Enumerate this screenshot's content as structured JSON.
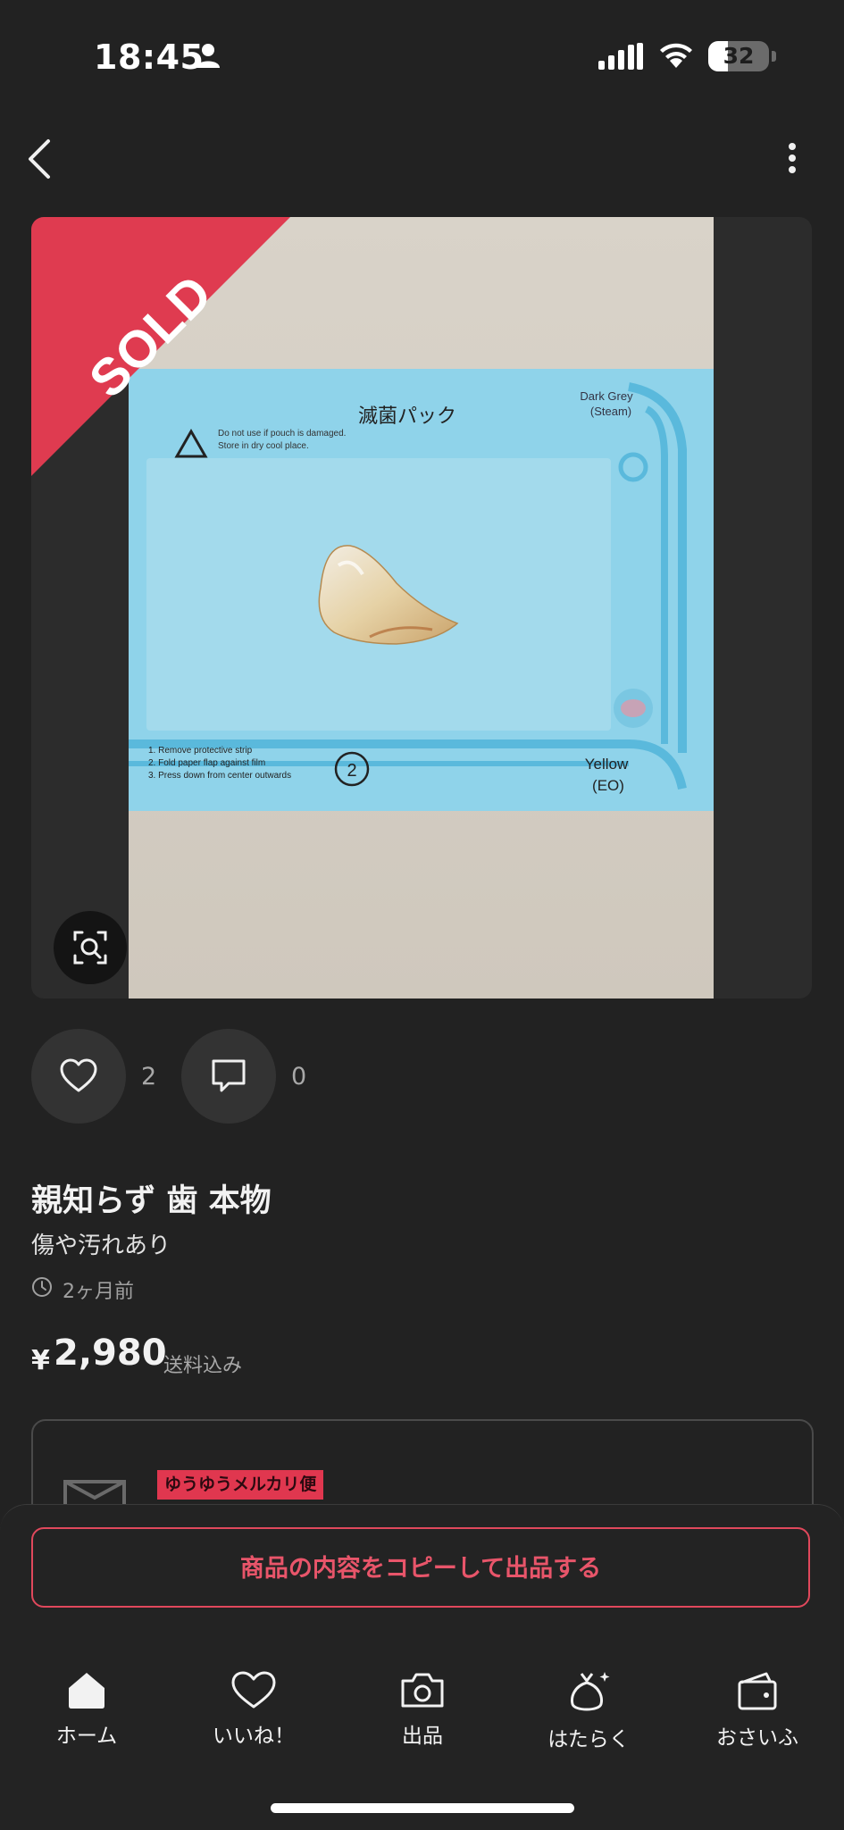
{
  "status_bar": {
    "time": "18:45",
    "battery": "32"
  },
  "product": {
    "sold_label": "SOLD",
    "photo_texts": {
      "pouch_title": "滅菌パック",
      "warning": "Do not use if pouch is damaged. Store in dry cool place.",
      "dark_grey": "Dark Grey (Steam)",
      "yellow": "Yellow (EO)",
      "instructions": [
        "1. Remove protective strip",
        "2. Fold paper flap against film",
        "3. Press down from center outwards"
      ]
    },
    "likes": "2",
    "comments": "0",
    "title": "親知らず 歯 本物",
    "condition": "傷や汚れあり",
    "posted": "2ヶ月前",
    "price_currency": "¥",
    "price": "2,980",
    "price_note": "送料込み"
  },
  "shipping": {
    "method": "ゆうゆうメルカリ便"
  },
  "copy_button": "商品の内容をコピーして出品する",
  "tabs": [
    {
      "label": "ホーム",
      "icon": "home-icon"
    },
    {
      "label": "いいね！",
      "icon": "heart-icon"
    },
    {
      "label": "出品",
      "icon": "camera-icon"
    },
    {
      "label": "はたらく",
      "icon": "money-bag-icon"
    },
    {
      "label": "おさいふ",
      "icon": "wallet-icon"
    }
  ],
  "colors": {
    "background": "#222222",
    "accent": "#e0374f",
    "sold_ribbon": "#df3b50"
  }
}
